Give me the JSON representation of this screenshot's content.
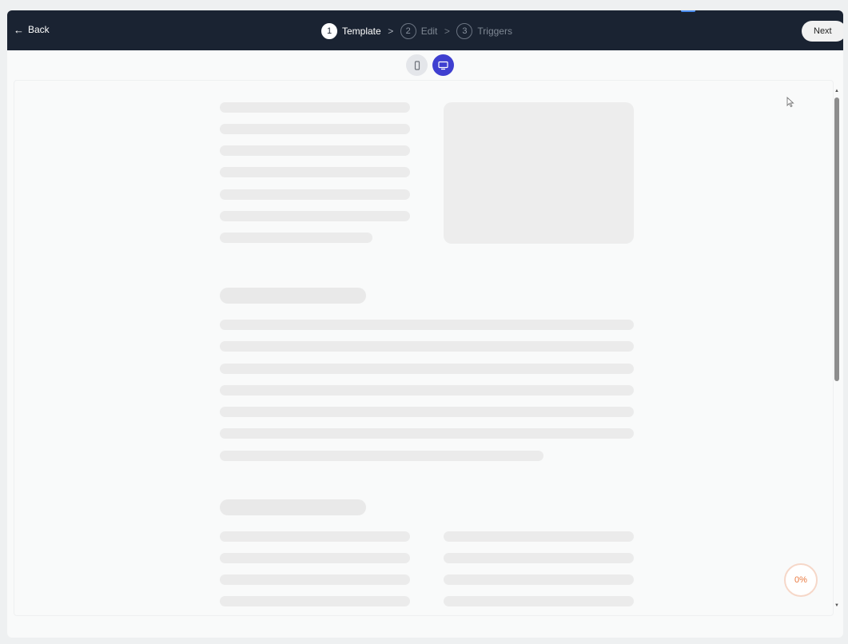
{
  "topbar": {
    "back_label": "Back",
    "next_label": "Next",
    "steps": [
      {
        "number": "1",
        "label": "Template",
        "active": true
      },
      {
        "number": "2",
        "label": "Edit",
        "active": false
      },
      {
        "number": "3",
        "label": "Triggers",
        "active": false
      }
    ]
  },
  "view_toggle": {
    "options": [
      "mobile",
      "desktop"
    ],
    "selected": "desktop"
  },
  "progress": {
    "label": "0%",
    "value": 0
  },
  "colors": {
    "topbar_bg": "#1a2332",
    "accent": "#3f3fd0",
    "progress": "#e9793f"
  }
}
